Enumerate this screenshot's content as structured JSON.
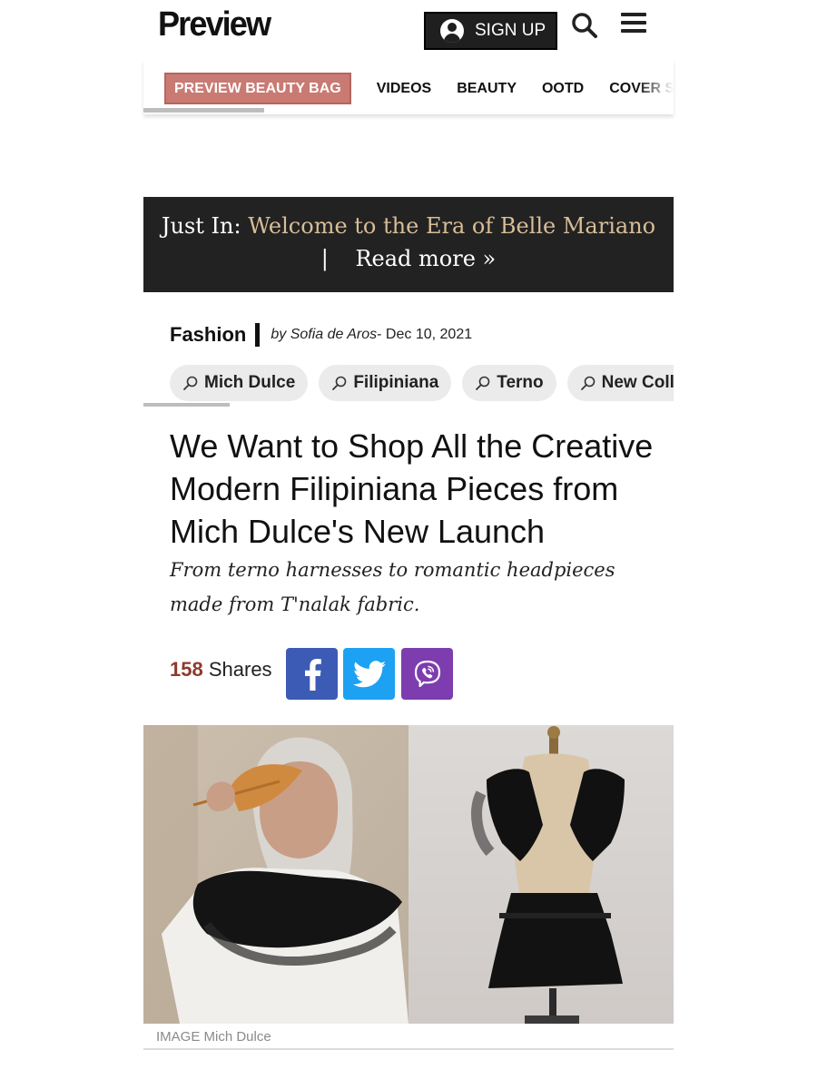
{
  "header": {
    "logo": "Preview",
    "signup_label": "SIGN UP"
  },
  "nav": {
    "badge": "PREVIEW BEAUTY BAG",
    "items": [
      "VIDEOS",
      "BEAUTY",
      "OOTD",
      "COVER STORY"
    ]
  },
  "just_in": {
    "prefix": "Just In:",
    "headline": "Welcome to the Era of Belle Mariano",
    "separator": "|",
    "read_more": "Read more »"
  },
  "article": {
    "category": "Fashion",
    "author": "by Sofia de Aros",
    "date": "- Dec 10, 2021",
    "tags": [
      "Mich Dulce",
      "Filipiniana",
      "Terno",
      "New Collection"
    ],
    "title": "We Want to Shop All the Creative Modern Filipiniana Pieces from Mich Dulce's New Launch",
    "subtitle": "From terno harnesses to romantic headpieces made from T'nalak fabric.",
    "shares_count": "158",
    "shares_label": "Shares",
    "image_caption": "IMAGE Mich Dulce"
  },
  "colors": {
    "nav_badge": "#c97a72",
    "banner_bg": "#222222",
    "banner_highlight": "#d8bd98",
    "shares_count": "#8e3a2c",
    "facebook": "#3b5bb5",
    "twitter": "#1da1f2",
    "viber": "#7d3daf"
  },
  "icons": {
    "signup": "user-circle-icon",
    "search": "search-icon",
    "menu": "hamburger-menu-icon",
    "tag": "search-icon",
    "share": [
      "facebook-icon",
      "twitter-icon",
      "viber-icon"
    ]
  }
}
